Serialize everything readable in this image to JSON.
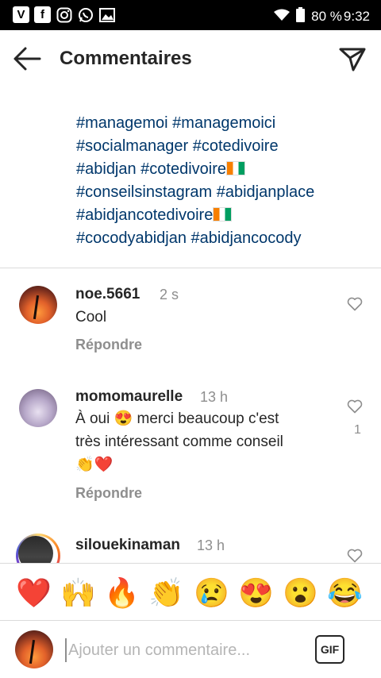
{
  "status_bar": {
    "battery": "80 %",
    "time": "9:32",
    "left_icons": [
      "v-app-icon",
      "facebook-icon",
      "instagram-icon",
      "whatsapp-icon",
      "gallery-icon"
    ]
  },
  "header": {
    "title": "Commentaires"
  },
  "caption": {
    "lines": [
      "#managemoi #managemoici",
      "#socialmanager #cotedivoire",
      "#abidjan #cotedivoire",
      "#conseilsinstagram #abidjanplace",
      "#abidjancotedivoire",
      "#cocodyabidjan #abidjancocody"
    ]
  },
  "comments": [
    {
      "username": "noe.5661",
      "time": "2 s",
      "text": "Cool",
      "reply_label": "Répondre",
      "likes": ""
    },
    {
      "username": "momomaurelle",
      "time": "13 h",
      "text_line1": "À oui 😍 merci beaucoup c'est",
      "text_line2": "très intéressant comme conseil",
      "text_line3": "👏❤️",
      "reply_label": "Répondre",
      "likes": "1"
    },
    {
      "username": "silouekinaman",
      "time": "13 h",
      "text": "",
      "likes": ""
    }
  ],
  "emoji_bar": [
    "❤️",
    "🙌",
    "🔥",
    "👏",
    "😢",
    "😍",
    "😮",
    "😂"
  ],
  "input": {
    "placeholder": "Ajouter un commentaire...",
    "gif_label": "GIF"
  },
  "colors": {
    "hashtag": "#00376b",
    "muted": "#8e8e8e",
    "text": "#262626"
  }
}
